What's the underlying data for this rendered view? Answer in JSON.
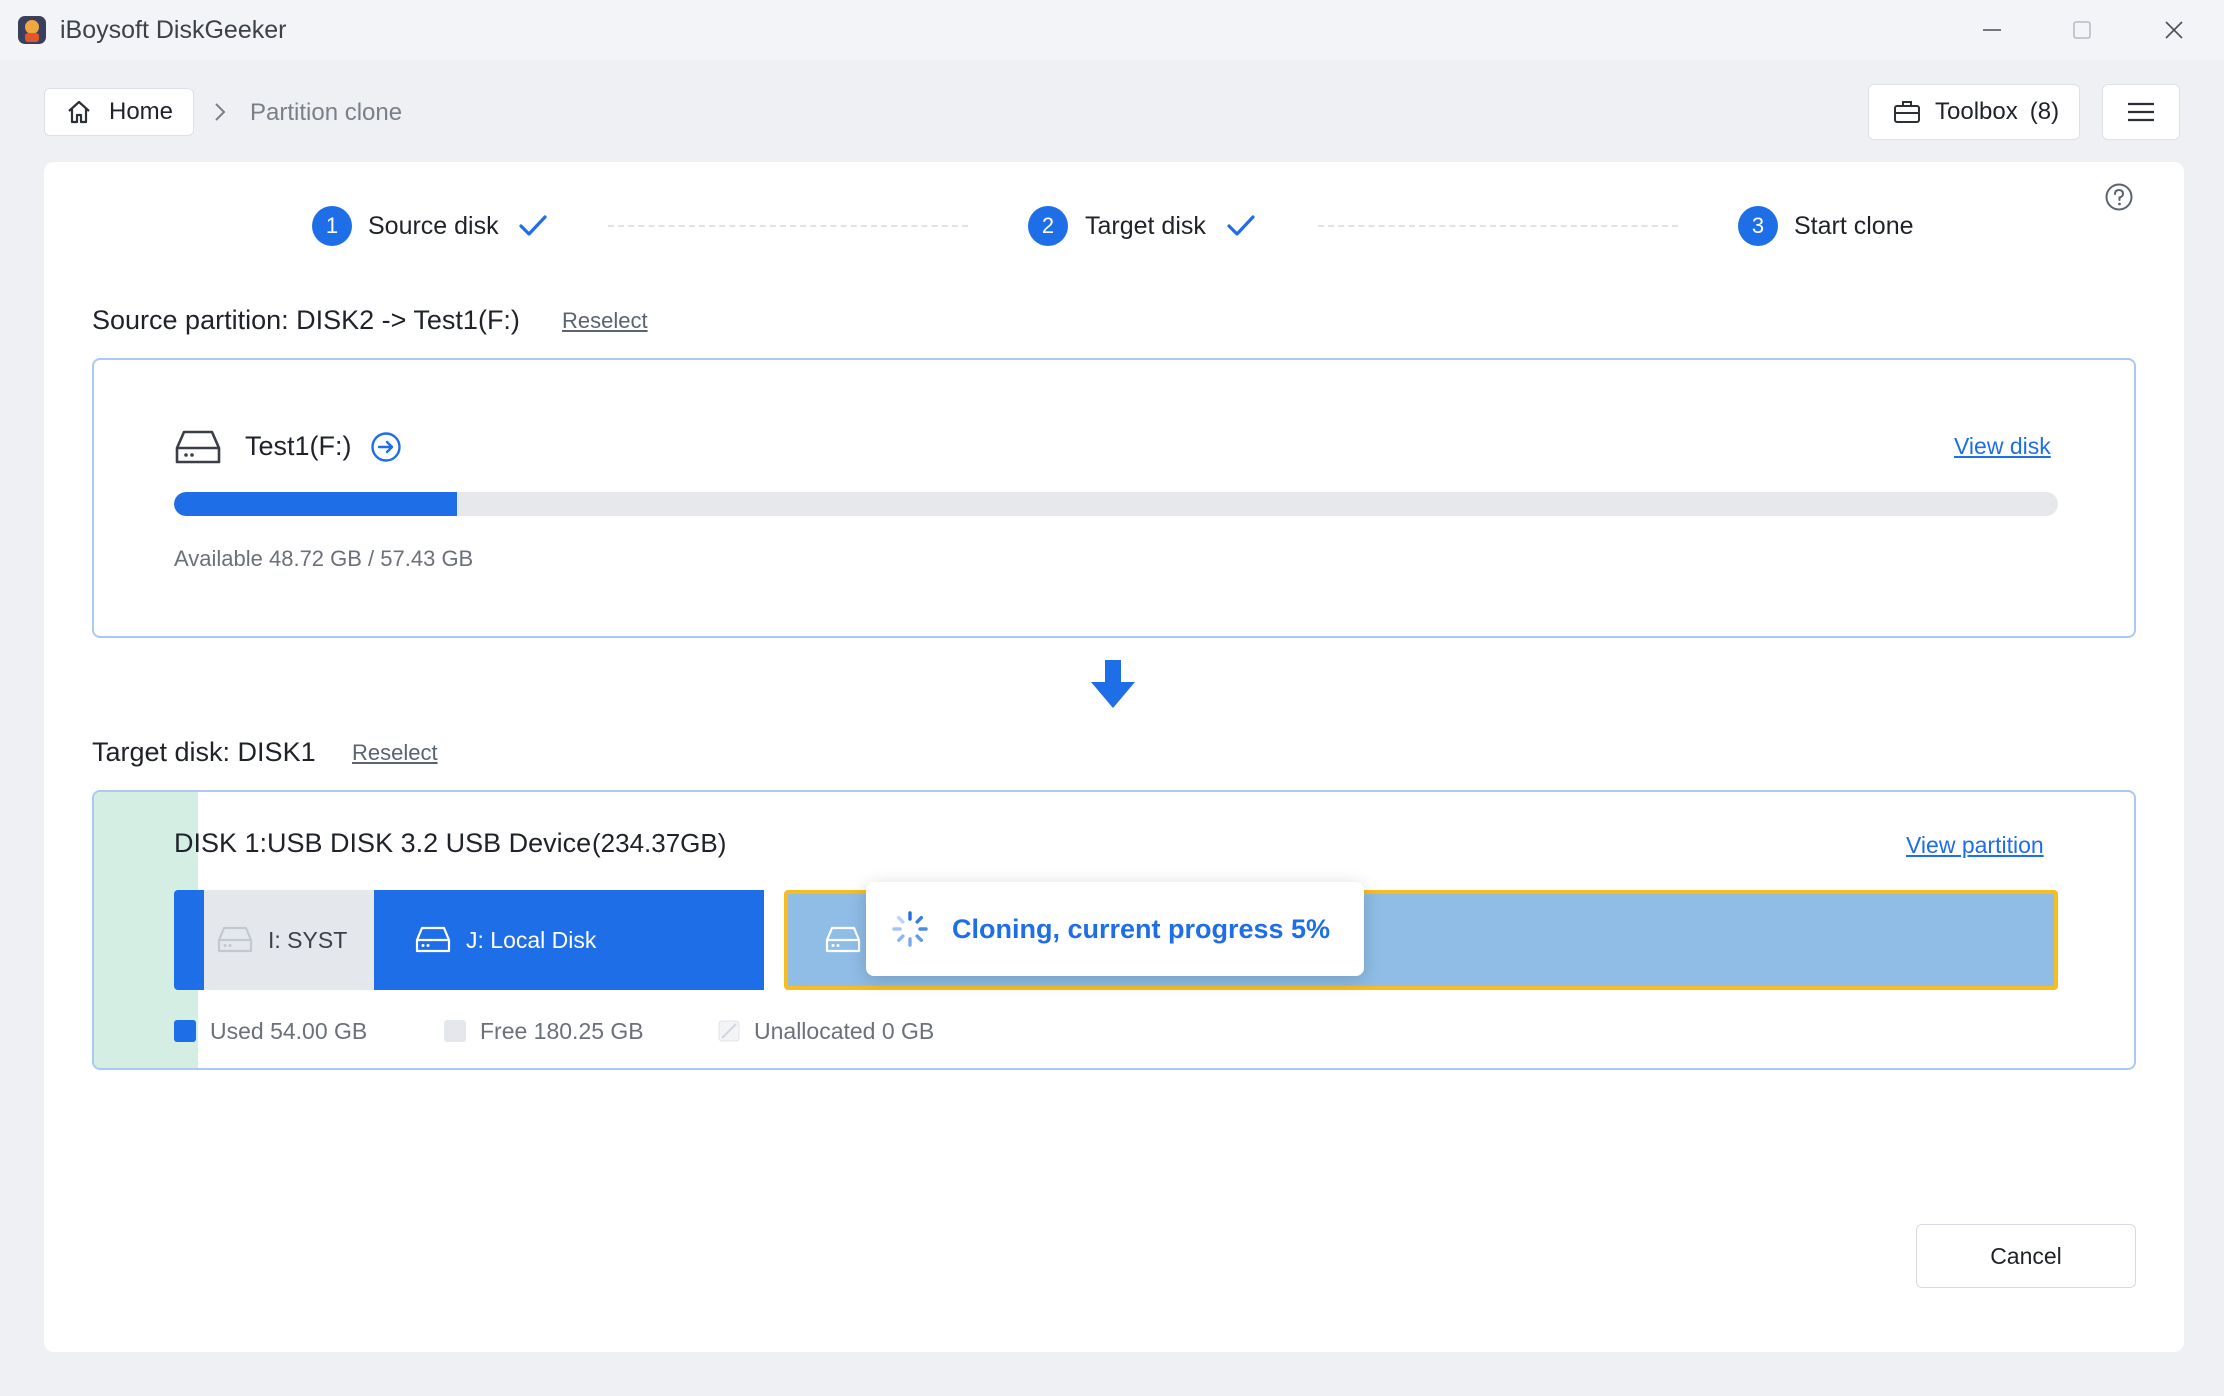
{
  "window": {
    "title": "iBoysoft DiskGeeker",
    "controls": [
      "minimize-icon",
      "maximize-icon",
      "close-icon"
    ]
  },
  "nav": {
    "home_label": "Home",
    "breadcrumb_current": "Partition clone",
    "toolbox_label": "Toolbox",
    "toolbox_count": "(8)"
  },
  "steps": [
    {
      "number": "1",
      "label": "Source disk",
      "done": true
    },
    {
      "number": "2",
      "label": "Target disk",
      "done": true
    },
    {
      "number": "3",
      "label": "Start clone",
      "done": false
    }
  ],
  "source": {
    "title": "Source partition: DISK2 -> Test1(F:)",
    "reselect": "Reselect",
    "partition_name": "Test1(F:)",
    "view_link": "View disk",
    "used_fraction": 0.15,
    "available_text": "Available 48.72 GB / 57.43 GB"
  },
  "target": {
    "title": "Target disk: DISK1",
    "reselect": "Reselect",
    "disk_name": "DISK 1:USB DISK 3.2 USB Device",
    "disk_size": "(234.37GB)",
    "view_link": "View partition",
    "partitions": [
      {
        "label": "I: SYST"
      },
      {
        "label": "J: Local Disk"
      }
    ],
    "legend": {
      "used": "Used 54.00 GB",
      "free": "Free 180.25 GB",
      "unallocated": "Unallocated 0 GB"
    }
  },
  "progress": {
    "text": "Cloning, current progress 5%",
    "percent": 5
  },
  "actions": {
    "cancel": "Cancel"
  },
  "colors": {
    "accent": "#1e6ee8",
    "selected_border": "#f5bd1f",
    "partition_fill": "#8fbde6",
    "used_stripe": "#d4eee3"
  }
}
